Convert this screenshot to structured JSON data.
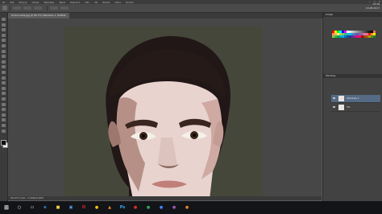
{
  "app": {
    "menu": [
      "Ps",
      "Plik",
      "Edycja",
      "Obraz",
      "Warstwa",
      "Tekst",
      "Zaznacz",
      "Filtr",
      "3D",
      "Widok",
      "Okno",
      "Pomoc"
    ],
    "window_controls": [
      "—",
      "□",
      "✕"
    ]
  },
  "document": {
    "tab_label": "konturowka.jpg @ 66,7% (Warstwa 1, RGB/8)",
    "status": "66,67%    Dok.: 2,06M/2,06M"
  },
  "panels": {
    "swatches_title": "Próbki",
    "layers_title": "Warstwy",
    "layers": [
      {
        "name": "Warstwa 1",
        "selected": true
      },
      {
        "name": "Tło",
        "selected": false
      }
    ]
  },
  "swatch_colors": [
    "#ff0000",
    "#ffff00",
    "#00ff00",
    "#00ffff",
    "#0000ff",
    "#ff00ff",
    "#ffffff",
    "#e6e6e6",
    "#cccccc",
    "#b3b3b3",
    "#999999",
    "#808080",
    "#666666",
    "#4d4d4d",
    "#333333",
    "#1a1a1a",
    "#000000",
    "#f26c4f",
    "#f68e55",
    "#fbaf5c",
    "#fff467",
    "#acd372",
    "#7cc576",
    "#3bb878",
    "#1abbb4",
    "#00bff3",
    "#438ccb",
    "#5574b9",
    "#605ca8",
    "#855fa8",
    "#a763a8",
    "#f06ea9",
    "#f26d7d",
    "#ed1c24",
    "#f7941d",
    "#fff200",
    "#8dc63f",
    "#39b54a",
    "#00a651",
    "#00a99d",
    "#00aeef",
    "#0072bc",
    "#0054a6",
    "#2e3192",
    "#662d91",
    "#92278f",
    "#ec008c",
    "#ed145b",
    "#9e0b0f",
    "#a0410d",
    "#a36209",
    "#aba000",
    "#598527",
    "#1a7b30"
  ],
  "taskbar": {
    "start_glyph": "⊞",
    "apps": [
      {
        "name": "search",
        "glyph": "○",
        "color": "#ffffff"
      },
      {
        "name": "task-view",
        "glyph": "▭",
        "color": "#ffffff"
      },
      {
        "name": "edge",
        "glyph": "e",
        "color": "#3a8ee6"
      },
      {
        "name": "explorer",
        "glyph": "■",
        "color": "#f2c94c"
      },
      {
        "name": "store",
        "glyph": "▣",
        "color": "#5aa0e6"
      },
      {
        "name": "opera",
        "glyph": "O",
        "color": "#e2242f"
      },
      {
        "name": "chrome",
        "glyph": "●",
        "color": "#f4c20d"
      },
      {
        "name": "vlc",
        "glyph": "▲",
        "color": "#f08a24"
      },
      {
        "name": "photoshop",
        "glyph": "Ps",
        "color": "#31a8ff"
      },
      {
        "name": "app-red",
        "glyph": "●",
        "color": "#d93025"
      },
      {
        "name": "app-green",
        "glyph": "●",
        "color": "#34a853"
      },
      {
        "name": "app-blue",
        "glyph": "●",
        "color": "#4285f4"
      },
      {
        "name": "app-purple",
        "glyph": "●",
        "color": "#9b59b6"
      },
      {
        "name": "app-orange",
        "glyph": "●",
        "color": "#e67e22"
      }
    ],
    "time": "15:38",
    "date": "18.08.2017"
  }
}
